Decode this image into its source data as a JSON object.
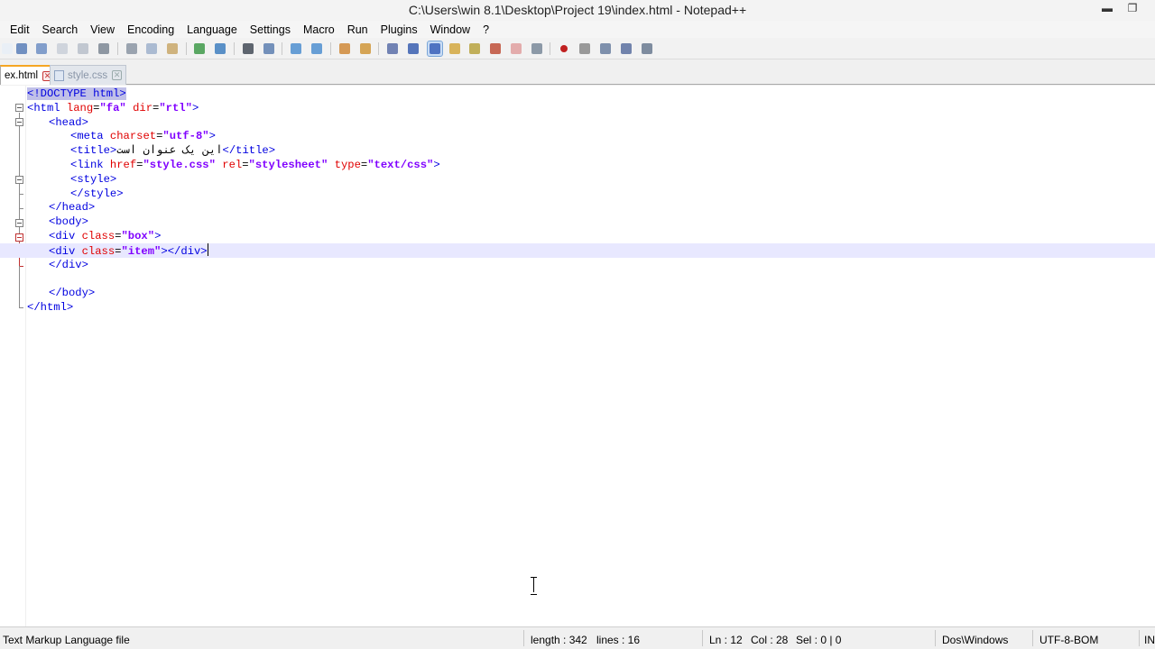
{
  "window": {
    "title": "C:\\Users\\win 8.1\\Desktop\\Project 19\\index.html - Notepad++",
    "minimize_glyph": "▬",
    "restore_glyph": "❐"
  },
  "menu": [
    "Edit",
    "Search",
    "View",
    "Encoding",
    "Language",
    "Settings",
    "Macro",
    "Run",
    "Plugins",
    "Window",
    "?"
  ],
  "toolbar": {
    "icons": [
      "new-file",
      "save",
      "save-all",
      "close",
      "close-all",
      "print",
      "cut",
      "copy",
      "paste",
      "undo",
      "redo",
      "find",
      "replace",
      "zoom-in",
      "zoom-out",
      "sync-vertical",
      "sync-horizontal",
      "word-wrap",
      "show-all-characters",
      "indent-guide",
      "user-defined-language",
      "document-map",
      "function-list",
      "folder-as-workspace",
      "monitoring",
      "record-macro",
      "stop-recording",
      "play-macro",
      "run-macro-multiple",
      "save-macro"
    ],
    "active": "indent-guide"
  },
  "tabs": [
    {
      "label": "ex.html",
      "active": true
    },
    {
      "label": "style.css",
      "active": false
    }
  ],
  "editor": {
    "current_line": 12,
    "lines": [
      [
        {
          "t": "hl-tag",
          "v": "<!DOCTYPE html>"
        }
      ],
      [
        {
          "t": "tag",
          "v": "<html "
        },
        {
          "t": "attr",
          "v": "lang"
        },
        {
          "t": "plain",
          "v": "="
        },
        {
          "t": "val",
          "v": "\"fa\""
        },
        {
          "t": "plain",
          "v": " "
        },
        {
          "t": "attr",
          "v": "dir"
        },
        {
          "t": "plain",
          "v": "="
        },
        {
          "t": "val",
          "v": "\"rtl\""
        },
        {
          "t": "tag",
          "v": ">"
        }
      ],
      [
        {
          "t": "tag",
          "v": "<head>"
        }
      ],
      [
        {
          "t": "tag",
          "v": "<meta "
        },
        {
          "t": "attr",
          "v": "charset"
        },
        {
          "t": "plain",
          "v": "="
        },
        {
          "t": "val",
          "v": "\"utf-8\""
        },
        {
          "t": "tag",
          "v": ">"
        }
      ],
      [
        {
          "t": "tag",
          "v": "<title>"
        },
        {
          "t": "plain",
          "v": "این یک عنوان است"
        },
        {
          "t": "tag",
          "v": "</title>"
        }
      ],
      [
        {
          "t": "tag",
          "v": "<link "
        },
        {
          "t": "attr",
          "v": "href"
        },
        {
          "t": "plain",
          "v": "="
        },
        {
          "t": "val",
          "v": "\"style.css\""
        },
        {
          "t": "plain",
          "v": " "
        },
        {
          "t": "attr",
          "v": "rel"
        },
        {
          "t": "plain",
          "v": "="
        },
        {
          "t": "val",
          "v": "\"stylesheet\""
        },
        {
          "t": "plain",
          "v": " "
        },
        {
          "t": "attr",
          "v": "type"
        },
        {
          "t": "plain",
          "v": "="
        },
        {
          "t": "val",
          "v": "\"text/css\""
        },
        {
          "t": "tag",
          "v": ">"
        }
      ],
      [
        {
          "t": "tag",
          "v": "<style>"
        }
      ],
      [
        {
          "t": "tag",
          "v": "</style>"
        }
      ],
      [
        {
          "t": "tag",
          "v": "</head>"
        }
      ],
      [
        {
          "t": "tag",
          "v": "<body>"
        }
      ],
      [
        {
          "t": "tag",
          "v": "<div "
        },
        {
          "t": "attr",
          "v": "class"
        },
        {
          "t": "plain",
          "v": "="
        },
        {
          "t": "val",
          "v": "\"box\""
        },
        {
          "t": "tag",
          "v": ">"
        }
      ],
      [
        {
          "t": "tag",
          "v": "<div "
        },
        {
          "t": "attr",
          "v": "class"
        },
        {
          "t": "plain",
          "v": "="
        },
        {
          "t": "val",
          "v": "\"item\""
        },
        {
          "t": "tag",
          "v": "></div>"
        }
      ],
      [
        {
          "t": "tag",
          "v": "</div>"
        }
      ],
      [],
      [
        {
          "t": "tag",
          "v": "</body>"
        }
      ],
      [
        {
          "t": "tag",
          "v": "</html>"
        }
      ]
    ]
  },
  "statusbar": {
    "file_type": "Text Markup Language file",
    "length": "length : 342",
    "lines": "lines : 16",
    "ln": "Ln : 12",
    "col": "Col : 28",
    "sel": "Sel : 0 | 0",
    "eol": "Dos\\Windows",
    "encoding": "UTF-8-BOM",
    "mode": "IN"
  },
  "colors": {
    "tag": "#0000e0",
    "attribute": "#e00000",
    "value": "#8000ff",
    "current_line": "#e8e8ff",
    "active_tab_accent": "#f5a623"
  }
}
